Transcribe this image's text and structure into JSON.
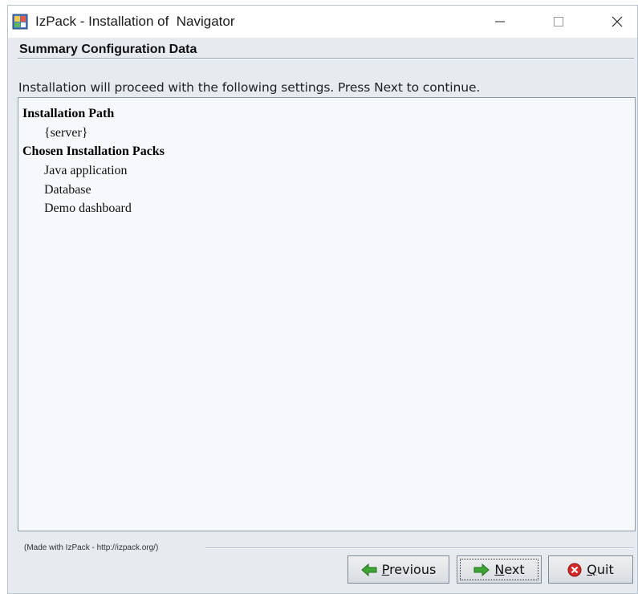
{
  "window": {
    "title": "IzPack - Installation of  Navigator"
  },
  "panel": {
    "header": "Summary Configuration Data",
    "intro": "Installation will proceed with the following settings. Press Next to continue.",
    "sections": [
      {
        "heading": "Installation Path",
        "items": [
          "{server}"
        ]
      },
      {
        "heading": "Chosen Installation Packs",
        "items": [
          "Java application",
          "Database",
          "Demo dashboard"
        ]
      }
    ]
  },
  "footer": {
    "credit": "(Made with IzPack - http://izpack.org/)"
  },
  "buttons": {
    "previous": "Previous",
    "next": "Next",
    "quit": "Quit"
  },
  "colors": {
    "accent_green": "#3fa535",
    "quit_red": "#d62828",
    "window_bg": "#e6ebf0"
  }
}
